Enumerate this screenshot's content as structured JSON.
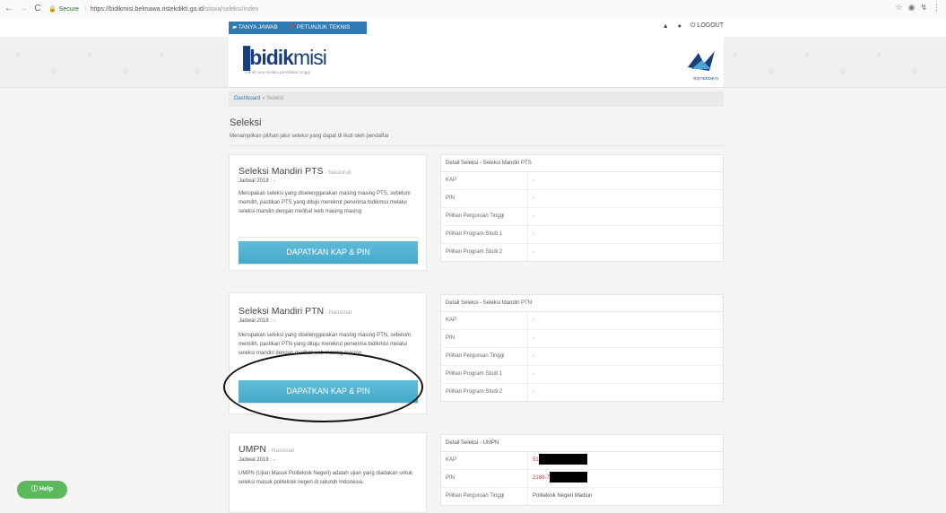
{
  "browser": {
    "secure_label": "Secure",
    "url_host": "https://bidikmisi.belmawa.ristekdikti.go.id",
    "url_path": "/siswa/seleksi/index"
  },
  "topnav": {
    "tanya_jawab": "TANYA JAWAB",
    "petunjuk_teknis": "PETUNJUK TEKNIS",
    "logout": "LOGOUT"
  },
  "header": {
    "logo_bidik": "bidik",
    "logo_misi": "misi",
    "logo_tagline": "meraih asa melalui pendidikan tinggi",
    "partner_label": "RISTEKDIKTI"
  },
  "breadcrumb": {
    "home": "Dashboard",
    "separator": " » ",
    "current": "Seleksi"
  },
  "page": {
    "title": "Seleksi",
    "subtitle": "Menampilkan pilihan jalur seleksi yang dapat di ikuti oleh pendaftar"
  },
  "cards": [
    {
      "title": "Seleksi Mandiri PTS",
      "scope": " - Nasional",
      "jadwal": "Jadwal 2018 : -",
      "description": "Merupakan seleksi yang diselenggarakan masing masing PTS, sebelum memilih, pastikan PTS yang dituju merekrut penerima bidikmisi melalui seleksi mandiri dengan melihat web masing masing",
      "button": "DAPATKAN KAP & PIN",
      "detail_title": "Detail Seleksi - Seleksi Mandiri PTS",
      "rows": [
        {
          "k": "KAP",
          "v": "-"
        },
        {
          "k": "PIN",
          "v": "-"
        },
        {
          "k": "Pilihan Perguruan Tinggi",
          "v": "-"
        },
        {
          "k": "Pilihan Program Studi 1",
          "v": "-"
        },
        {
          "k": "Pilihan Program Studi 2",
          "v": "-"
        }
      ]
    },
    {
      "title": "Seleksi Mandiri PTN",
      "scope": " - Nasional",
      "jadwal": "Jadwal 2018 : -",
      "description": "Merupakan seleksi yang diselenggarakan masing masing PTN, sebelum memilih, pastikan PTN yang dituju merekrut penerima bidikmisi melalui seleksi mandiri dengan melihat web masing masing",
      "button": "DAPATKAN KAP & PIN",
      "detail_title": "Detail Seleksi - Seleksi Mandiri PTN",
      "rows": [
        {
          "k": "KAP",
          "v": "-"
        },
        {
          "k": "PIN",
          "v": "-"
        },
        {
          "k": "Pilihan Perguruan Tinggi",
          "v": "-"
        },
        {
          "k": "Pilihan Program Studi 1",
          "v": "-"
        },
        {
          "k": "Pilihan Program Studi 2",
          "v": "-"
        }
      ]
    },
    {
      "title": "UMPN",
      "scope": " - Nasional",
      "jadwal": "Jadwal 2018 : -",
      "description": "UMPN (Ujian Masuk Politeknik Negeri) adalah ujian yang diadakan untuk seleksi masuk politeknik negeri di seluruh Indonesia.",
      "detail_title": "Detail Seleksi - UMPN",
      "rows": [
        {
          "k": "KAP",
          "v": "51"
        },
        {
          "k": "PIN",
          "v": "2180-7"
        },
        {
          "k": "Pilihan Perguruan Tinggi",
          "v": "Politeknik Negeri Madiun"
        }
      ]
    }
  ],
  "help": {
    "label": "Help"
  },
  "colors": {
    "primary": "#2e7bb3",
    "button": "#4fb2d1",
    "help": "#5cb85c",
    "value_red": "#c0392b"
  }
}
